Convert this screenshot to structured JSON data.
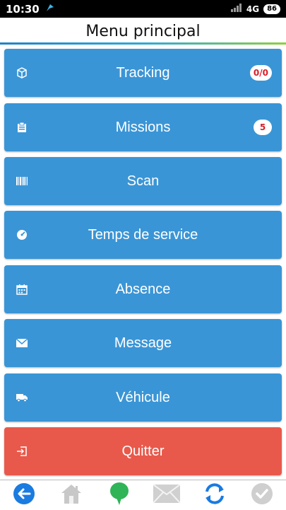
{
  "status_bar": {
    "time": "10:30",
    "network": "4G",
    "battery": "86"
  },
  "header": {
    "title": "Menu principal"
  },
  "menu": {
    "items": [
      {
        "label": "Tracking",
        "icon": "box-icon",
        "badge": "0/0"
      },
      {
        "label": "Missions",
        "icon": "clipboard-icon",
        "badge": "5"
      },
      {
        "label": "Scan",
        "icon": "barcode-icon"
      },
      {
        "label": "Temps de service",
        "icon": "gauge-icon"
      },
      {
        "label": "Absence",
        "icon": "calendar-icon"
      },
      {
        "label": "Message",
        "icon": "envelope-icon"
      },
      {
        "label": "Véhicule",
        "icon": "truck-icon"
      },
      {
        "label": "Quitter",
        "icon": "exit-icon"
      }
    ]
  },
  "bottom_bar": {
    "buttons": [
      "back-arrow-icon",
      "home-icon",
      "chat-bubble-icon",
      "mail-icon",
      "sync-icon",
      "check-icon"
    ]
  },
  "colors": {
    "primary": "#3a95d6",
    "danger": "#e8594b",
    "badge_text": "#d8202a"
  }
}
